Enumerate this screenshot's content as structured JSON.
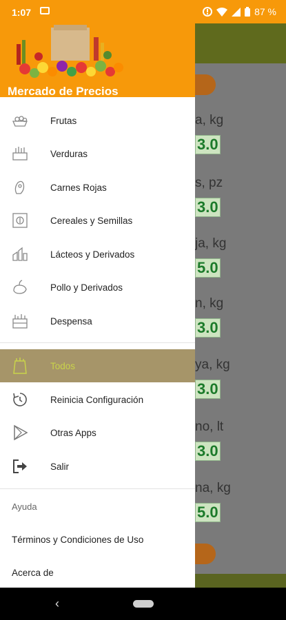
{
  "status_bar": {
    "time": "1:07",
    "battery": "87 %"
  },
  "drawer": {
    "header_title": "Mercado de Precios",
    "categories": [
      {
        "label": "Frutas",
        "icon": "fruits-icon"
      },
      {
        "label": "Verduras",
        "icon": "vegetables-icon"
      },
      {
        "label": "Carnes Rojas",
        "icon": "meat-icon"
      },
      {
        "label": "Cereales y Semillas",
        "icon": "cereals-icon"
      },
      {
        "label": "Lácteos y Derivados",
        "icon": "dairy-icon"
      },
      {
        "label": "Pollo y Derivados",
        "icon": "chicken-icon"
      },
      {
        "label": "Despensa",
        "icon": "pantry-icon"
      }
    ],
    "selected": {
      "label": "Todos",
      "icon": "grocery-icon"
    },
    "actions": [
      {
        "label": "Reinicia Configuración",
        "icon": "reset-icon"
      },
      {
        "label": "Otras Apps",
        "icon": "play-store-icon"
      },
      {
        "label": "Salir",
        "icon": "exit-icon"
      }
    ],
    "help": {
      "section_title": "Ayuda",
      "terms": "Términos y Condiciones de Uso",
      "about": "Acerca de"
    }
  },
  "background_list": {
    "items": [
      {
        "name": "a, kg",
        "price": "3.0"
      },
      {
        "name": "s, pz",
        "price": "3.0"
      },
      {
        "name": "ja, kg",
        "price": "5.0"
      },
      {
        "name": "n, kg",
        "price": "3.0"
      },
      {
        "name": "ya, kg",
        "price": "3.0"
      },
      {
        "name": "no, lt",
        "price": "3.0"
      },
      {
        "name": "na, kg",
        "price": "5.0"
      }
    ]
  },
  "colors": {
    "accent": "#f7990a",
    "selected_bg": "#a69569",
    "selected_text": "#c9d34a",
    "price_text": "#1c7a2a"
  }
}
